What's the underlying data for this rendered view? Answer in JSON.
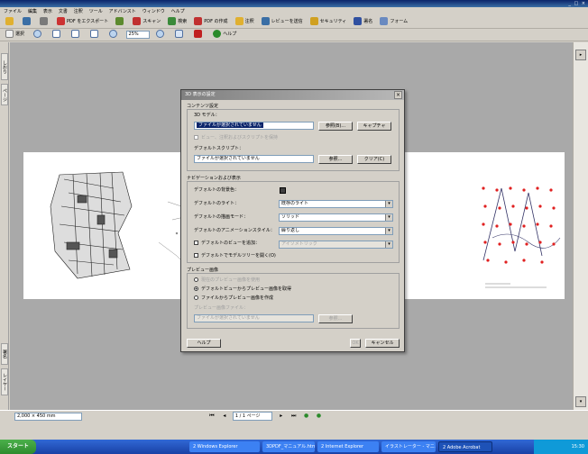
{
  "app": {
    "window_controls": "_ □ ×"
  },
  "menu": [
    "ファイル",
    "編集",
    "表示",
    "文書",
    "注釈",
    "ツール",
    "アドバンスト",
    "ウィンドウ",
    "ヘルプ"
  ],
  "toolbar1": [
    {
      "label": "",
      "icon": "open-icon",
      "color": "#e0b030"
    },
    {
      "label": "",
      "icon": "save-icon",
      "color": "#3a6ea5"
    },
    {
      "label": "",
      "icon": "print-icon",
      "color": "#7a7a7a"
    },
    {
      "label": "PDF をエクスポート",
      "icon": "export-icon",
      "color": "#cc3333"
    },
    {
      "label": "",
      "icon": "sign-icon",
      "color": "#5c8a2e"
    },
    {
      "label": "スキャン",
      "icon": "scan-icon",
      "color": "#c03030"
    },
    {
      "label": "検索",
      "icon": "search-icon",
      "color": "#3a8a3a"
    },
    {
      "label": "PDF の作成",
      "icon": "create-pdf-icon",
      "color": "#c03030"
    },
    {
      "label": "注釈",
      "icon": "comment-icon",
      "color": "#e0b030"
    },
    {
      "label": "レビューを送信",
      "icon": "review-icon",
      "color": "#3a6ea5"
    },
    {
      "label": "セキュリティ",
      "icon": "lock-icon",
      "color": "#d0a020"
    },
    {
      "label": "署名",
      "icon": "pen-icon",
      "color": "#3050a0"
    },
    {
      "label": "フォーム",
      "icon": "form-icon",
      "color": "#6a8ac0"
    }
  ],
  "toolbar2": {
    "select_label": "選択",
    "zoom": "25%",
    "help_label": "ヘルプ"
  },
  "lefttabs": [
    "しおり",
    "ページ",
    "署名",
    "レイヤー"
  ],
  "dialog": {
    "title": "3D 表示の設定",
    "content_section": "コンテンツ設定",
    "model_label": "3D モデル：",
    "model_value": "ファイルが選択されていません",
    "browse_label": "参照(B)...",
    "capture_label": "キャプチャ",
    "preserve_checkbox": "ビュー、注釈およびスクリプトを保持",
    "script_label": "デフォルトスクリプト：",
    "script_value": "ファイルが選択されていません",
    "browse2_label": "参照...",
    "clear_label": "クリア(C)",
    "nav_section": "ナビゲーションおよび表示",
    "bg_color_label": "デフォルトの背景色：",
    "lighting_label": "デフォルトのライト：",
    "lighting_value": "既存のライト",
    "render_label": "デフォルトの描画モード：",
    "render_value": "ソリッド",
    "anim_label": "デフォルトのアニメーションスタイル：",
    "anim_value": "繰り返し",
    "add_view_checkbox": "デフォルトのビューを追加：",
    "add_view_value": "アイソメトリック",
    "toolbar_checkbox": "デフォルトでモデルツリーを開く(O)",
    "preview_section": "プレビュー画像",
    "radio_existing": "現在のプレビュー画像を使用",
    "radio_default_view": "デフォルトビューからプレビュー画像を取得",
    "radio_file": "ファイルからプレビュー画像を作成",
    "preview_file_label": "プレビュー画像ファイル：",
    "preview_file_value": "ファイルが選択されていません",
    "browse3_label": "参照...",
    "help_button": "ヘルプ",
    "ok_button": "OK",
    "cancel_button": "キャンセル"
  },
  "status": {
    "page_size": "2,000 × 450 mm",
    "page_box": "1 / 1 ページ"
  },
  "taskbar": {
    "start": "スタート",
    "tasks": [
      {
        "label": "2 Windows Explorer",
        "active": false
      },
      {
        "label": "3DPDF_マニュアル.htm",
        "active": false
      },
      {
        "label": "2 Internet Explorer",
        "active": false
      },
      {
        "label": "イラストレーター - マニュアル",
        "active": false
      },
      {
        "label": "2 Adobe Acrobat",
        "active": true
      }
    ],
    "clock": "15:30"
  }
}
